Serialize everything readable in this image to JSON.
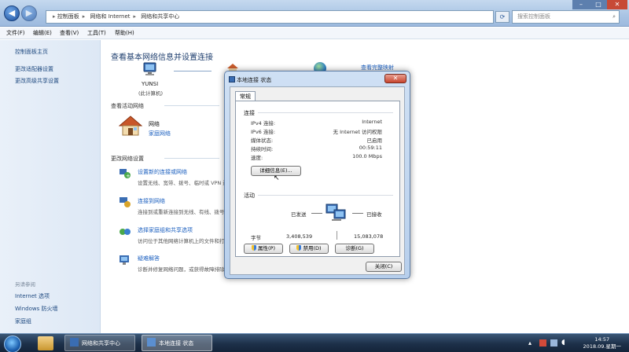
{
  "address": {
    "crumbs": [
      "控制面板",
      "网络和 Internet",
      "网络和共享中心"
    ]
  },
  "search": {
    "placeholder": "搜索控制面板"
  },
  "menu": [
    "文件(F)",
    "编辑(E)",
    "查看(V)",
    "工具(T)",
    "帮助(H)"
  ],
  "sidebar": {
    "home": "控制面板主页",
    "links": [
      "更改适配器设置",
      "更改高级共享设置"
    ],
    "see_also_title": "另请参阅",
    "see_also": [
      "Internet 选项",
      "Windows 防火墙",
      "家庭组"
    ]
  },
  "main": {
    "title": "查看基本网络信息并设置连接",
    "see_full_map": "查看完整映射",
    "computer_name": "YUNSI",
    "computer_sub": "(此计算机)",
    "active_networks_head": "查看活动网络",
    "network_name": "网络",
    "network_type": "家庭网络",
    "change_settings_head": "更改网络设置",
    "tasks": [
      {
        "title": "设置新的连接或网络",
        "desc": "设置无线、宽带、拨号、临时或 VPN 连接；或设置路由器或访问点。"
      },
      {
        "title": "连接到网络",
        "desc": "连接到或重新连接到无线、有线、拨号或 VPN 网络连接。"
      },
      {
        "title": "选择家庭组和共享选项",
        "desc": "访问位于其他网络计算机上的文件和打印机，或更改共享设置。"
      },
      {
        "title": "疑难解答",
        "desc": "诊断并修复网络问题，或获得故障排除信息。"
      }
    ]
  },
  "dialog": {
    "title": "本地连接 状态",
    "tab": "常规",
    "connection_head": "连接",
    "rows": [
      {
        "key": "IPv4 连接:",
        "value": "Internet"
      },
      {
        "key": "IPv6 连接:",
        "value": "无 Internet 访问权限"
      },
      {
        "key": "媒体状态:",
        "value": "已启用"
      },
      {
        "key": "持续时间:",
        "value": "00:59:11"
      },
      {
        "key": "速度:",
        "value": "100.0 Mbps"
      }
    ],
    "details_button": "详细信息(E)...",
    "activity_head": "活动",
    "sent_label": "已发送",
    "received_label": "已接收",
    "bytes_label": "字节",
    "bytes_sent": "3,408,539",
    "bytes_received": "15,083,078",
    "properties_button": "属性(P)",
    "disable_button": "禁用(D)",
    "diagnose_button": "诊断(G)",
    "close_button": "关闭(C)"
  },
  "taskbar": {
    "items": [
      "网络和共享中心",
      "本地连接 状态"
    ],
    "time": "14:57",
    "date": "2018.09.星期一"
  },
  "colors": {
    "link": "#1b5fbf",
    "title": "#1e3e6e",
    "taskbar": "#1d3049"
  }
}
